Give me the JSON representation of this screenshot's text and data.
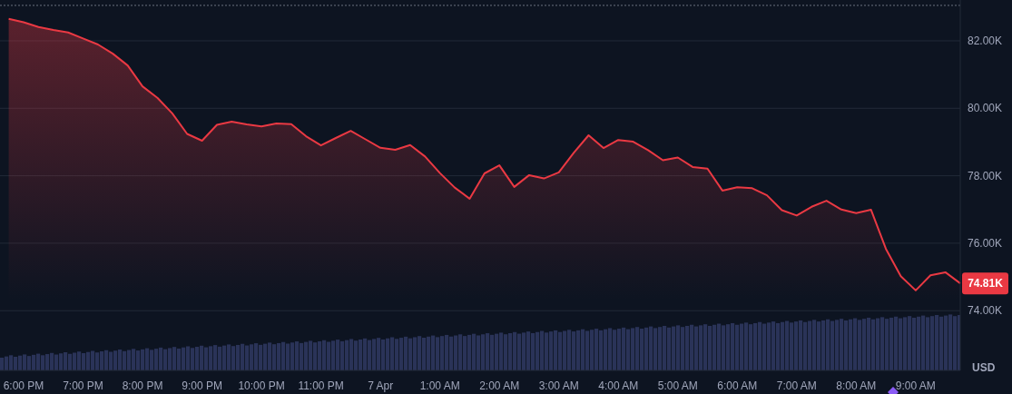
{
  "chart": {
    "price_label": "74.81K",
    "chart_data": {
      "type": "area",
      "grid": true,
      "ylabel": "USD",
      "ylim": [
        72.23,
        83.21
      ],
      "categories": [
        null,
        "6:00 PM",
        null,
        null,
        null,
        "7:00 PM",
        null,
        null,
        null,
        "8:00 PM",
        null,
        null,
        null,
        "9:00 PM",
        null,
        null,
        null,
        "10:00 PM",
        null,
        null,
        null,
        "11:00 PM",
        null,
        null,
        null,
        "7 Apr",
        null,
        null,
        null,
        "1:00 AM",
        null,
        null,
        null,
        "2:00 AM",
        null,
        null,
        null,
        "3:00 AM",
        null,
        null,
        null,
        "4:00 AM",
        null,
        null,
        null,
        "5:00 AM",
        null,
        null,
        null,
        "6:00 AM",
        null,
        null,
        null,
        "7:00 AM",
        null,
        null,
        null,
        "8:00 AM",
        null,
        null,
        null,
        "9:00 AM",
        null,
        null,
        null
      ],
      "yticks": [
        {
          "value": 74,
          "label": "74.00K"
        },
        {
          "value": 76,
          "label": "76.00K"
        },
        {
          "value": 78,
          "label": "78.00K"
        },
        {
          "value": 80,
          "label": "80.00K"
        },
        {
          "value": 82,
          "label": "82.00K"
        }
      ],
      "ref_lines": [
        {
          "axis": "y",
          "value": 83.05
        }
      ],
      "series": [
        {
          "color": "#ea3943",
          "values": [
            82.65,
            82.55,
            82.41,
            82.32,
            82.25,
            82.07,
            81.89,
            81.62,
            81.27,
            80.65,
            80.31,
            79.85,
            79.24,
            79.04,
            79.51,
            79.6,
            79.52,
            79.46,
            79.55,
            79.53,
            79.17,
            78.9,
            79.12,
            79.33,
            79.08,
            78.83,
            78.77,
            78.91,
            78.57,
            78.08,
            77.65,
            77.32,
            78.07,
            78.31,
            77.67,
            78.02,
            77.92,
            78.1,
            78.68,
            79.2,
            78.82,
            79.06,
            79.01,
            78.76,
            78.46,
            78.54,
            78.26,
            78.21,
            77.56,
            77.66,
            77.63,
            77.42,
            76.98,
            76.82,
            77.08,
            77.26,
            77,
            76.89,
            76.99,
            75.83,
            75.02,
            74.6,
            75.05,
            75.14,
            74.81
          ]
        }
      ]
    }
  }
}
